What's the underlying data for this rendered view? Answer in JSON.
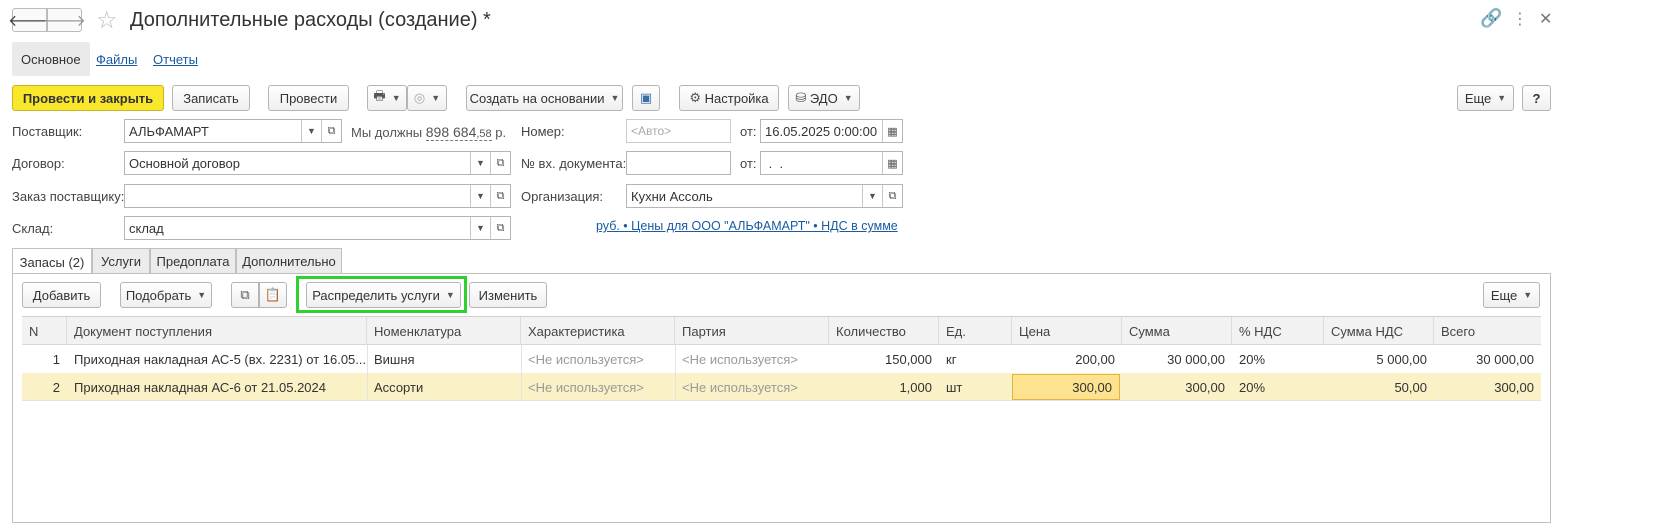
{
  "window": {
    "title": "Дополнительные расходы (создание) *",
    "back_icon": "arrow-left-icon",
    "forward_icon": "arrow-right-icon",
    "favorite_icon": "star-icon"
  },
  "sections": [
    "Основное",
    "Файлы",
    "Отчеты"
  ],
  "toolbar": {
    "post_close": "Провести и закрыть",
    "save": "Записать",
    "post": "Провести",
    "create_based": "Создать на основании",
    "settings": "Настройка",
    "edo": "ЭДО",
    "more": "Еще",
    "help": "?"
  },
  "form": {
    "supplier_label": "Поставщик:",
    "supplier_value": "АЛЬФАМАРТ",
    "debt_text": "Мы должны",
    "debt_int": "898 684",
    "debt_frac": ",58",
    "debt_currency": "р.",
    "contract_label": "Договор:",
    "contract_value": "Основной договор",
    "order_label": "Заказ поставщику:",
    "order_value": "",
    "warehouse_label": "Склад:",
    "warehouse_value": "склад",
    "number_label": "Номер:",
    "number_placeholder": "<Авто>",
    "date_from_label": "от:",
    "date_value": "16.05.2025  0:00:00",
    "incoming_doc_label": "№ вх. документа:",
    "incoming_doc_value": "",
    "incoming_from_label": "от:",
    "incoming_date_value": " .  .",
    "organization_label": "Организация:",
    "organization_value": "Кухни Ассоль",
    "price_link": "руб. • Цены для ООО \"АЛЬФАМАРТ\" • НДС в сумме"
  },
  "tabs": [
    "Запасы (2)",
    "Услуги",
    "Предоплата",
    "Дополнительно"
  ],
  "table_toolbar": {
    "add": "Добавить",
    "pick": "Подобрать",
    "distribute": "Распределить услуги",
    "change": "Изменить",
    "more": "Еще"
  },
  "table": {
    "columns": [
      "N",
      "Документ поступления",
      "Номенклатура",
      "Характеристика",
      "Партия",
      "Количество",
      "Ед.",
      "Цена",
      "Сумма",
      "% НДС",
      "Сумма НДС",
      "Всего"
    ],
    "rows": [
      [
        "1",
        "Приходная накладная АС-5 (вх. 2231) от 16.05....",
        "Вишня",
        "<Не используется>",
        "<Не используется>",
        "150,000",
        "кг",
        "200,00",
        "30 000,00",
        "20%",
        "5 000,00",
        "30 000,00"
      ],
      [
        "2",
        "Приходная накладная АС-6 от 21.05.2024",
        "Ассорти",
        "<Не используется>",
        "<Не используется>",
        "1,000",
        "шт",
        "300,00",
        "300,00",
        "20%",
        "50,00",
        "300,00"
      ]
    ]
  },
  "colors": {
    "primary_button": "#f9e72b",
    "highlight_border": "#2fd12f",
    "selected_row": "#fbf1c6",
    "link": "#1a5aa0"
  }
}
